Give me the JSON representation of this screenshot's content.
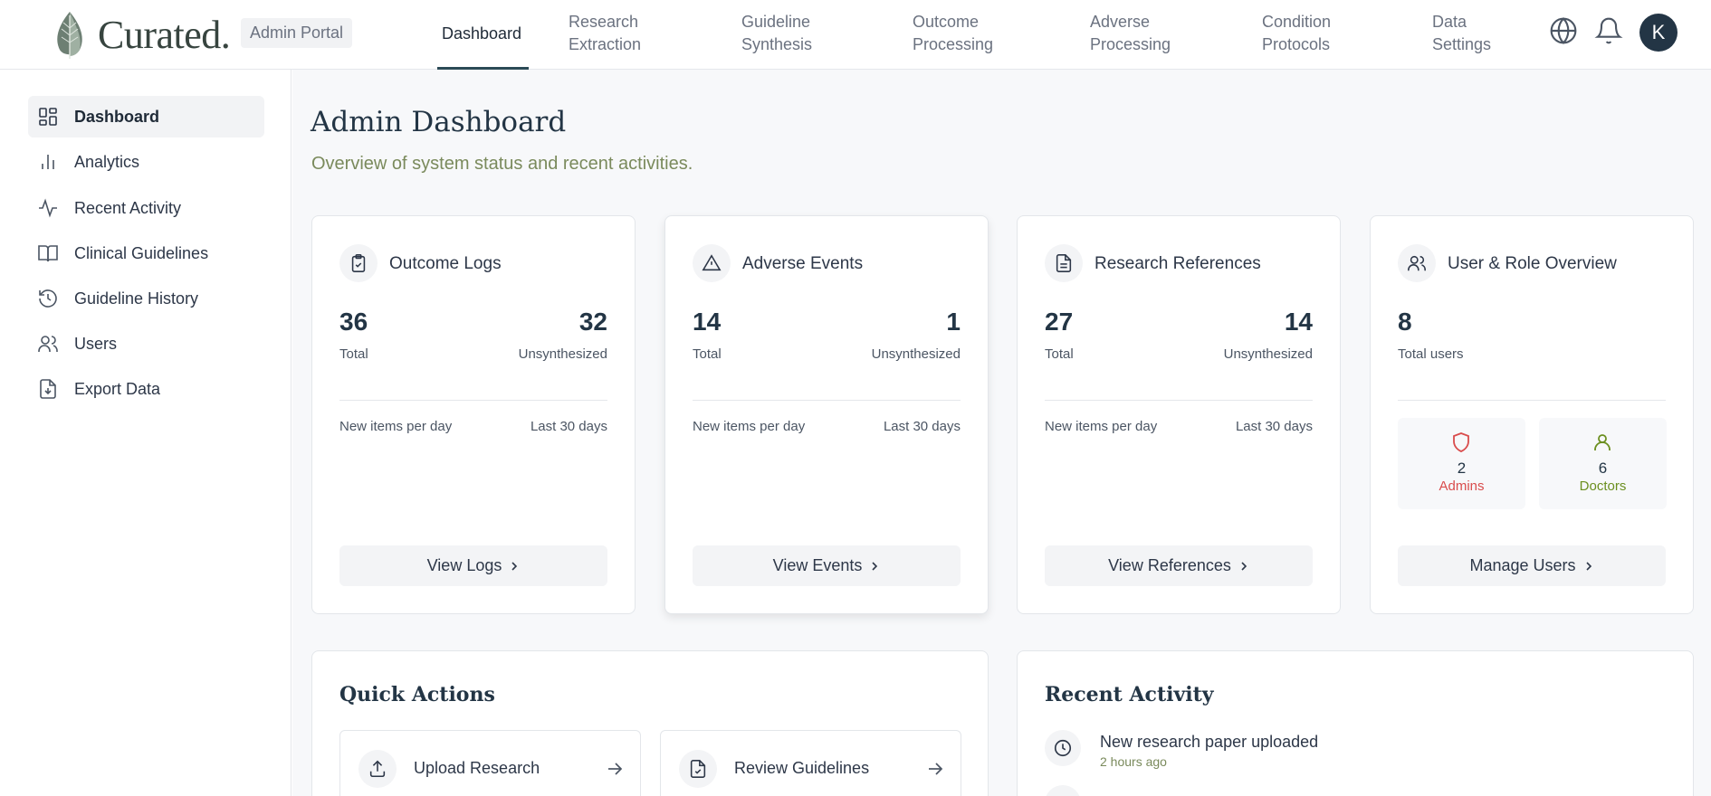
{
  "brand": {
    "name": "Curated.",
    "portal_badge": "Admin Portal"
  },
  "topnav": {
    "items": [
      {
        "label": "Dashboard",
        "active": true
      },
      {
        "label": "Research\nExtraction"
      },
      {
        "label": "Guideline\nSynthesis"
      },
      {
        "label": "Outcome\nProcessing"
      },
      {
        "label": "Adverse\nProcessing"
      },
      {
        "label": "Condition\nProtocols"
      },
      {
        "label": "Data\nSettings"
      }
    ],
    "icons": [
      "globe-icon",
      "bell-icon"
    ],
    "avatar_initial": "K"
  },
  "sidebar": {
    "items": [
      {
        "label": "Dashboard",
        "icon": "dashboard-grid-icon",
        "active": true
      },
      {
        "label": "Analytics",
        "icon": "bar-chart-icon"
      },
      {
        "label": "Recent Activity",
        "icon": "activity-pulse-icon"
      },
      {
        "label": "Clinical Guidelines",
        "icon": "open-book-icon"
      },
      {
        "label": "Guideline History",
        "icon": "history-clock-icon"
      },
      {
        "label": "Users",
        "icon": "users-icon"
      },
      {
        "label": "Export Data",
        "icon": "file-download-icon"
      }
    ]
  },
  "page": {
    "title": "Admin Dashboard",
    "subtitle": "Overview of system status and recent activities."
  },
  "cards": [
    {
      "title": "Outcome Logs",
      "icon": "clipboard-check-icon",
      "total": "36",
      "total_label": "Total",
      "unsynth": "32",
      "unsynth_label": "Unsynthesized",
      "chart_label": "New items per day",
      "chart_range": "Last 30 days",
      "button": "View Logs"
    },
    {
      "title": "Adverse Events",
      "icon": "alert-triangle-icon",
      "total": "14",
      "total_label": "Total",
      "unsynth": "1",
      "unsynth_label": "Unsynthesized",
      "chart_label": "New items per day",
      "chart_range": "Last 30 days",
      "button": "View Events"
    },
    {
      "title": "Research References",
      "icon": "document-icon",
      "total": "27",
      "total_label": "Total",
      "unsynth": "14",
      "unsynth_label": "Unsynthesized",
      "chart_label": "New items per day",
      "chart_range": "Last 30 days",
      "button": "View References"
    },
    {
      "title": "User & Role Overview",
      "icon": "users-icon",
      "total": "8",
      "total_label": "Total users",
      "admins": {
        "count": "2",
        "label": "Admins",
        "color": "#d94c4c",
        "icon": "shield-icon"
      },
      "doctors": {
        "count": "6",
        "label": "Doctors",
        "color": "#6b8f1f",
        "icon": "user-icon"
      },
      "button": "Manage Users"
    }
  ],
  "quick_actions": {
    "title": "Quick Actions",
    "items": [
      {
        "label": "Upload Research",
        "icon": "upload-icon"
      },
      {
        "label": "Review Guidelines",
        "icon": "file-check-icon"
      }
    ]
  },
  "recent_activity": {
    "title": "Recent Activity",
    "items": [
      {
        "title": "New research paper uploaded",
        "time": "2 hours ago",
        "icon": "clock-icon"
      }
    ]
  },
  "colors": {
    "accent": "#233545",
    "muted_green": "#7a8a5c",
    "page_bg": "#f7f8fa"
  }
}
